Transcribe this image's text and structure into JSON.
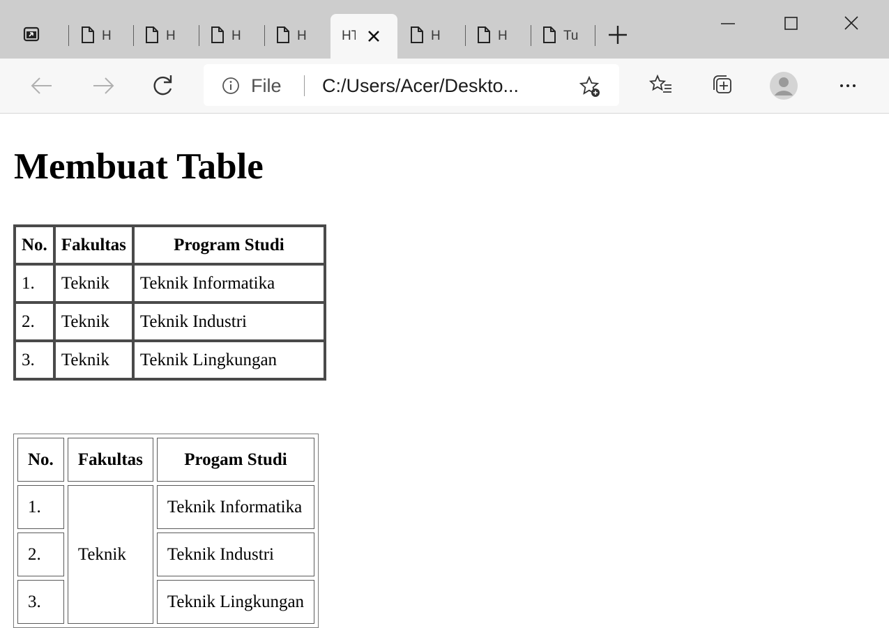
{
  "browser": {
    "tabs": [
      {
        "label": "H"
      },
      {
        "label": "H"
      },
      {
        "label": "H"
      },
      {
        "label": "H"
      },
      {
        "label": "HTML",
        "active": true
      },
      {
        "label": "H"
      },
      {
        "label": "H"
      },
      {
        "label": "Tu"
      }
    ],
    "address": {
      "scheme_label": "File",
      "url": "C:/Users/Acer/Deskto..."
    },
    "icons": [
      "tab-actions-icon",
      "document-icon",
      "close-icon",
      "new-tab-icon",
      "minimize-icon",
      "maximize-icon",
      "window-close-icon",
      "back-icon",
      "forward-icon",
      "refresh-icon",
      "info-icon",
      "add-favorite-icon",
      "favorites-icon",
      "collections-icon",
      "profile-icon",
      "more-icon"
    ]
  },
  "page": {
    "heading": "Membuat Table",
    "table1": {
      "headers": [
        "No.",
        "Fakultas",
        "Program Studi"
      ],
      "rows": [
        [
          "1.",
          "Teknik",
          "Teknik Informatika"
        ],
        [
          "2.",
          "Teknik",
          "Teknik Industri"
        ],
        [
          "3.",
          "Teknik",
          "Teknik Lingkungan"
        ]
      ]
    },
    "table2": {
      "headers": [
        "No.",
        "Fakultas",
        "Progam Studi"
      ],
      "fakultas": "Teknik",
      "rows": [
        [
          "1.",
          "Teknik Informatika"
        ],
        [
          "2.",
          "Teknik Industri"
        ],
        [
          "3.",
          "Teknik Lingkungan"
        ]
      ]
    }
  }
}
